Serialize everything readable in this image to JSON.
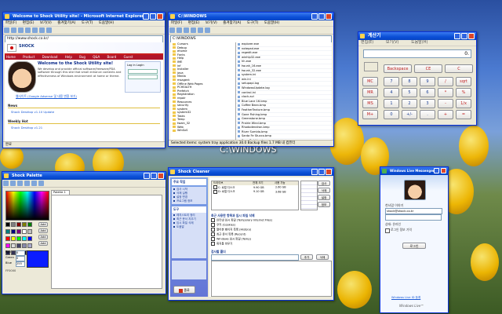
{
  "desktop": {
    "drive_label": "C:\\WINDOWS"
  },
  "browser": {
    "title": "Welcome to Shock Utility site! - Microsoft Internet Explorer",
    "menu": [
      "파일(F)",
      "편집(E)",
      "보기(V)",
      "즐겨찾기(A)",
      "도구(T)",
      "도움말(H)"
    ],
    "address": "http://www.shock.co.kr/",
    "nav": [
      "Home",
      "Product",
      "Download",
      "Help",
      "Bug",
      "Q&A",
      "Board",
      "Guest"
    ],
    "heading": "Welcome to the Shock Utility site!",
    "intro": "We develop and provide official software/freeware/PDA software through this site that small enhance contents and effectiveness of Windows environment at home or theme.",
    "link": "웹사이트 (Google Adsense 및 내용 변환 보기)",
    "news_title": "News",
    "news_item": "Shock Desktop v1.10 Update",
    "weekly_title": "Weekly Hot",
    "weekly_item": "Shock Desktop v1.21",
    "login": "Log in Login",
    "status": "완료"
  },
  "explorer": {
    "title": "C:\\WINDOWS",
    "menu": [
      "파일(F)",
      "편집(E)",
      "보기(V)",
      "즐겨찾기(A)",
      "도구(T)",
      "도움말(H)"
    ],
    "address": "C:\\WINDOWS",
    "folders": [
      "Cursors",
      "Debug",
      "ehome",
      "Fonts",
      "Help",
      "IME",
      "inf",
      "Installer",
      "java",
      "Media",
      "msagent",
      "Offline Web Pages",
      "PCHEALTH",
      "Prefetch",
      "Registration",
      "repair",
      "Resources",
      "security",
      "system",
      "system32",
      "Tasks",
      "Temp",
      "twain_32",
      "Web",
      "WinSxS"
    ],
    "files": [
      "explorer.exe",
      "notepad.exe",
      "regedit.exe",
      "winhlp32.exe",
      "hh.exe",
      "twunk_16.exe",
      "twunk_32.exe",
      "system.ini",
      "win.ini",
      "setupapi.log",
      "WindowsUpdate.log",
      "control.ini",
      "clock.avi",
      "Blue Lace 16.bmp",
      "Coffee Bean.bmp",
      "FeatherTexture.bmp",
      "Gone Fishing.bmp",
      "Greenstone.bmp",
      "Prairie Wind.bmp",
      "Rhododendron.bmp",
      "River Sumida.bmp",
      "Santa Fe Stucco.bmp",
      "Soap Bubbles.bmp",
      "Zapotec.bmp",
      "0.log"
    ],
    "status": "Selected items: system tray application  30.0 Backup files  1.7 MB  내 컴퓨터"
  },
  "calculator": {
    "title": "계산기",
    "menu": [
      "편집(E)",
      "보기(V)",
      "도움말(H)"
    ],
    "display": "0.",
    "top_buttons": [
      "Backspace",
      "CE",
      "C"
    ],
    "memory_buttons": [
      "MC",
      "MR",
      "MS",
      "M+"
    ],
    "rows": [
      [
        "7",
        "8",
        "9",
        "/",
        "sqrt"
      ],
      [
        "4",
        "5",
        "6",
        "*",
        "%"
      ],
      [
        "1",
        "2",
        "3",
        "-",
        "1/x"
      ],
      [
        "0",
        "+/-",
        ".",
        "+",
        "="
      ]
    ]
  },
  "palette": {
    "title": "Shock Palette",
    "tab": "Palette 1",
    "labels": [
      "Red",
      "Green",
      "Blue"
    ],
    "values": [
      "0",
      "0",
      "255"
    ],
    "add_buttons": [
      "Add",
      "Add",
      "Add",
      "Add"
    ],
    "hex": "FF0000"
  },
  "cleaner": {
    "title": "Shock Cleaner",
    "side_sections": [
      "주요 작업",
      "도구"
    ],
    "side_items": [
      "검사 시작",
      "삭제 실행",
      "설정 변경",
      "프로그램 정보",
      "레지스트리 정리",
      "최근 문서 지우기",
      "임시 파일 삭제",
      "도움말"
    ],
    "drive_header": [
      "드라이브",
      "전체 크기",
      "사용 가능"
    ],
    "drives": [
      [
        "C: 로컬 디스크",
        "9.90 GB",
        "2.60 GB"
      ],
      [
        "D: 로컬 디스크",
        "9.10 GB",
        "3.68 GB"
      ]
    ],
    "options_title": "최근 사용한 항목과 임시 파일 삭제",
    "options": [
      "인터넷 임시 파일 (Temporary Internet Files)",
      "쿠키 (Cookies)",
      "열어본 페이지 목록 (History)",
      "최근 문서 목록 (Recent)",
      "Windows 임시 파일 (Temp)",
      "휴지통 비우기"
    ],
    "list_label": "검사할 폴더",
    "add_button": "추가",
    "delete_button": "삭제",
    "close_button": "종료",
    "action_buttons": [
      "검사",
      "삭제",
      "설정",
      "정보"
    ]
  },
  "messenger": {
    "title": "Windows Live Messenger",
    "user_name": "천사맘 이야기",
    "user_email": "shock@shock.co.kr",
    "status_label": "상태: 온라인",
    "search_placeholder": "연락처 검색",
    "option_label": "로그인 정보 기억",
    "login_button": "로그인",
    "footer_link": "Windows Live ID 등록",
    "brand": "Windows Live™"
  }
}
